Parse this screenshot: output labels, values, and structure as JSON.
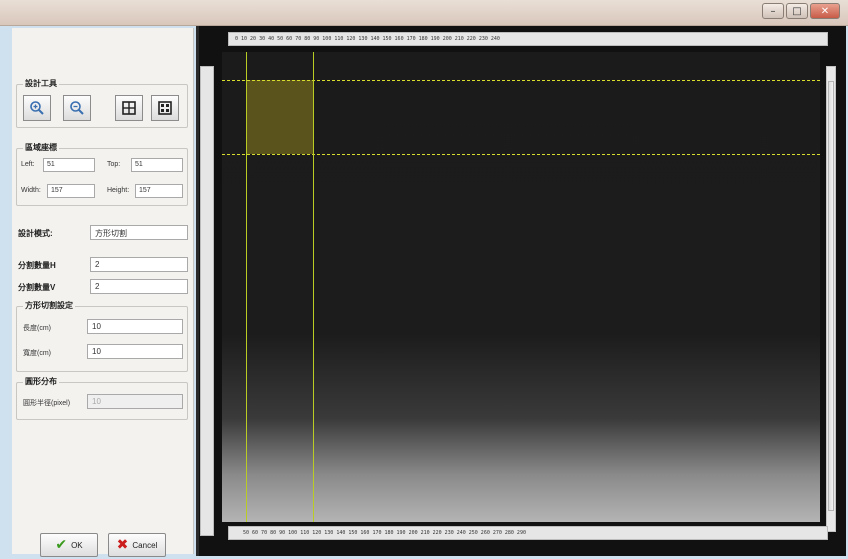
{
  "window": {
    "minimize_glyph": "–",
    "maximize_glyph": "□",
    "close_glyph": "✕"
  },
  "design_tools": {
    "title": "設計工具",
    "buttons": [
      {
        "name": "zoom-in-button",
        "icon": "zoom-in-icon"
      },
      {
        "name": "zoom-out-button",
        "icon": "zoom-out-icon"
      },
      {
        "name": "grid-4-button",
        "icon": "grid-icon"
      },
      {
        "name": "grid-9-button",
        "icon": "grid-fine-icon"
      }
    ]
  },
  "region_coords": {
    "title": "區域座標",
    "left_label": "Left:",
    "left_value": "51",
    "top_label": "Top:",
    "top_value": "51",
    "width_label": "Width:",
    "width_value": "157",
    "height_label": "Height:",
    "height_value": "157"
  },
  "design_mode": {
    "label": "設計模式:",
    "value": "方形切割"
  },
  "split_h": {
    "label": "分割數量H",
    "value": "2"
  },
  "split_v": {
    "label": "分割數量V",
    "value": "2"
  },
  "square_cut": {
    "title": "方形切割設定",
    "length_label": "長度(cm)",
    "length_value": "10",
    "width_label": "寬度(cm)",
    "width_value": "10"
  },
  "circle_dist": {
    "title": "圓形分布",
    "radius_label": "圓形半徑(pixel)",
    "radius_value": "10"
  },
  "actions": {
    "ok_glyph": "✔",
    "ok_label": "OK",
    "cancel_glyph": "✖",
    "cancel_label": "Cancel"
  },
  "rulers": {
    "top_ticks": "0    10    20    30    40    50    60    70    80    90    100   110   120   130   140   150   160   170   180   190   200   210   220   230   240",
    "bottom_ticks": "50    60    70    80    90    100   110   120   130   140   150   160   170   180   190   200   210   220   230   240   250   260   270   280   290"
  },
  "colors": {
    "selection_fill": "#70681e",
    "guide_line": "#d7dd2c",
    "ok_check": "#3a9a1e",
    "cancel_x": "#cc1d1d"
  }
}
